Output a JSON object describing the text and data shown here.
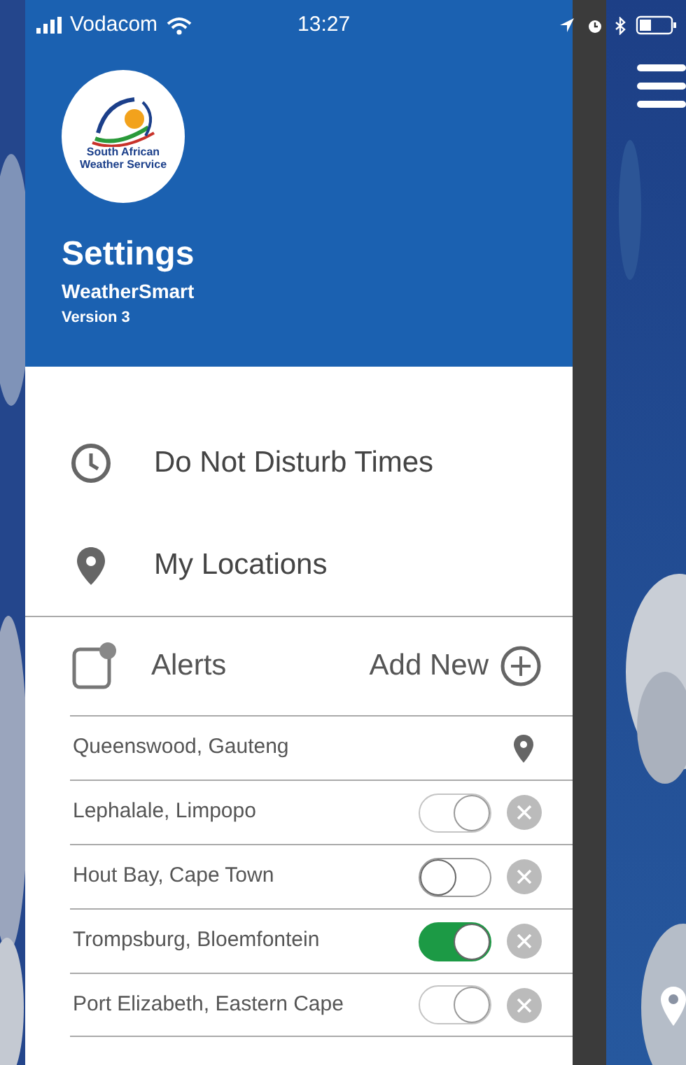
{
  "status_bar": {
    "carrier": "Vodacom",
    "time": "13:27"
  },
  "drawer": {
    "logo_text": [
      "South African",
      "Weather Service"
    ],
    "title": "Settings",
    "app_name": "WeatherSmart",
    "version": "Version 3",
    "menu": [
      {
        "kind": "clock",
        "label": "Do Not Disturb Times"
      },
      {
        "kind": "pin",
        "label": "My Locations"
      }
    ],
    "alerts": {
      "label": "Alerts",
      "add_label": "Add New",
      "rows": [
        {
          "kind": "current",
          "label": "Queenswood, Gauteng"
        },
        {
          "kind": "toggle",
          "label": "Lephalale, Limpopo",
          "on": true,
          "disabled": true
        },
        {
          "kind": "toggle",
          "label": "Hout Bay, Cape Town",
          "on": false,
          "disabled": false
        },
        {
          "kind": "toggle",
          "label": "Trompsburg, Bloemfontein",
          "on": true,
          "disabled": false
        },
        {
          "kind": "toggle",
          "label": "Port Elizabeth, Eastern Cape",
          "on": true,
          "disabled": true
        }
      ]
    }
  }
}
